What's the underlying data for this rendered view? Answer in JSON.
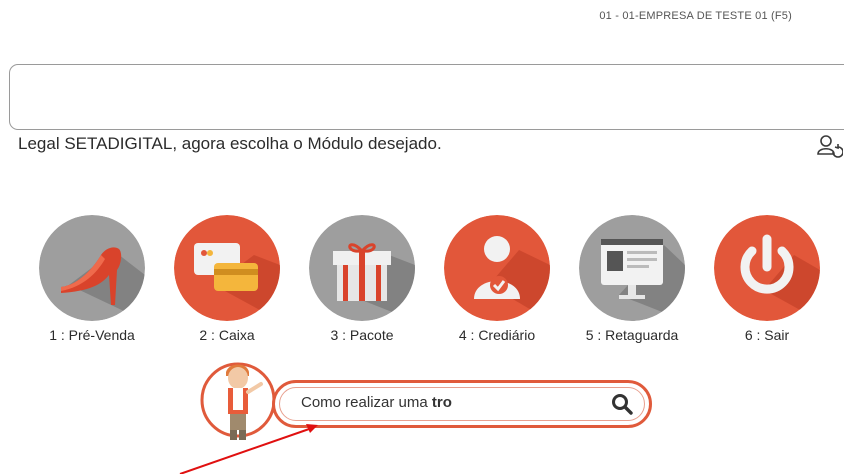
{
  "header": {
    "company": "01 - 01-EMPRESA DE TESTE 01 (F5)"
  },
  "message_box": {
    "text": ""
  },
  "greeting": "Legal SETADIGITAL, agora escolha o Módulo desejado.",
  "modules": [
    {
      "label": "1 : Pré-Venda",
      "icon": "high-heel-icon",
      "color": "#9e9e9e"
    },
    {
      "label": "2 : Caixa",
      "icon": "credit-card-icon",
      "color": "#e2573a"
    },
    {
      "label": "3 : Pacote",
      "icon": "gift-box-icon",
      "color": "#9e9e9e"
    },
    {
      "label": "4 : Crediário",
      "icon": "user-check-icon",
      "color": "#e2573a"
    },
    {
      "label": "5 : Retaguarda",
      "icon": "monitor-icon",
      "color": "#9e9e9e"
    },
    {
      "label": "6 : Sair",
      "icon": "power-icon",
      "color": "#e2573a"
    }
  ],
  "search": {
    "typed_prefix": "Como realizar uma ",
    "typed_bold": "tro"
  },
  "colors": {
    "accent": "#e2573a",
    "gray": "#9e9e9e"
  }
}
